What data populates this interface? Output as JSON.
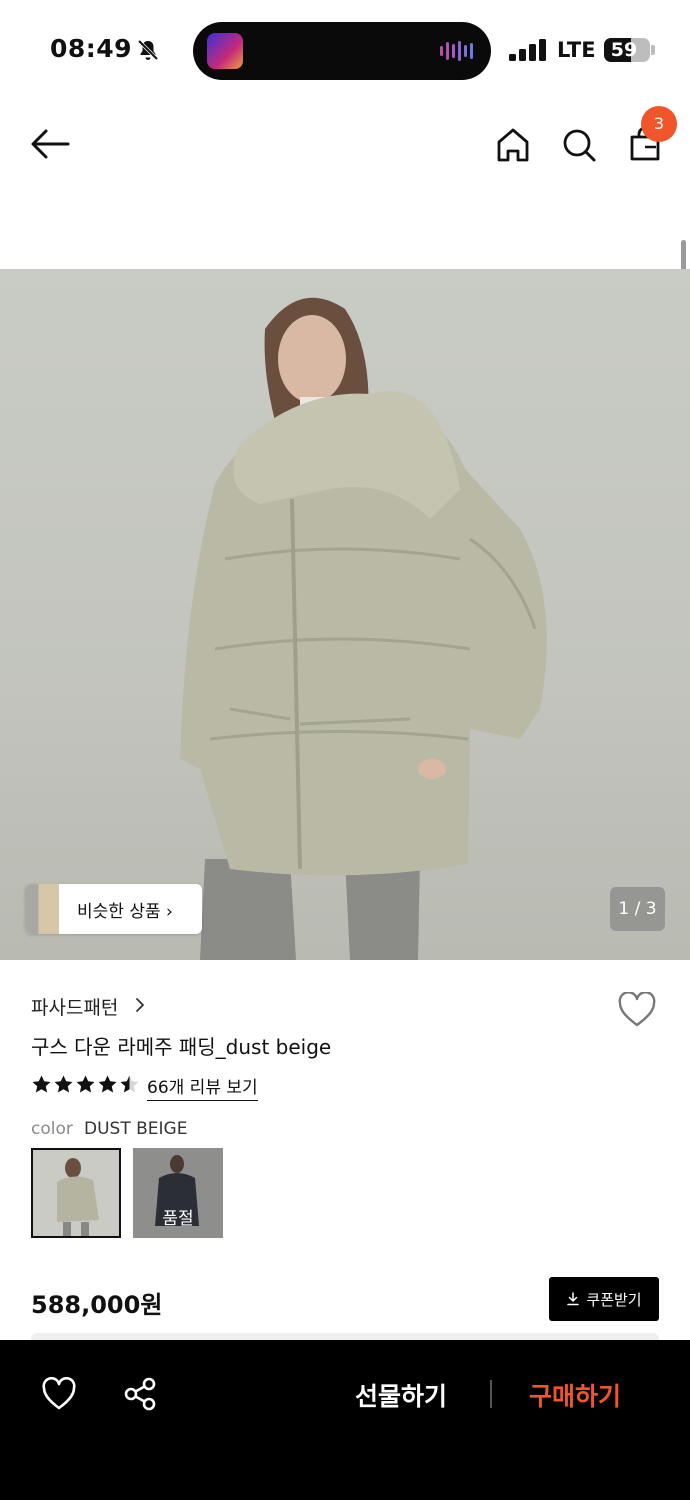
{
  "status_bar": {
    "time": "08:49",
    "network": "LTE",
    "battery_level": "59",
    "icons": [
      "bell-slash-icon",
      "music-app-icon",
      "audio-wave-icon",
      "signal-icon",
      "battery-icon"
    ]
  },
  "nav": {
    "icons": [
      "arrow-left-icon",
      "home-icon",
      "search-icon",
      "shopping-bag-icon"
    ],
    "cart_count": "3"
  },
  "gallery": {
    "similar_label": "비슷한 상품",
    "counter": "1 / 3"
  },
  "product": {
    "brand": "파사드패턴",
    "title": "구스 다운 라메주 패딩_dust beige",
    "rating": 4.5,
    "review_link": "66개 리뷰 보기",
    "color_label": "color",
    "color_value": "DUST BEIGE",
    "swatches": [
      {
        "color_name": "dust beige",
        "status": ""
      },
      {
        "color_name": "navy",
        "status": "품절"
      }
    ],
    "price": "588,000원",
    "coupon_label": "쿠폰받기"
  },
  "bottom_bar": {
    "gift_label": "선물하기",
    "buy_label": "구매하기",
    "accent": "#f0562a"
  }
}
